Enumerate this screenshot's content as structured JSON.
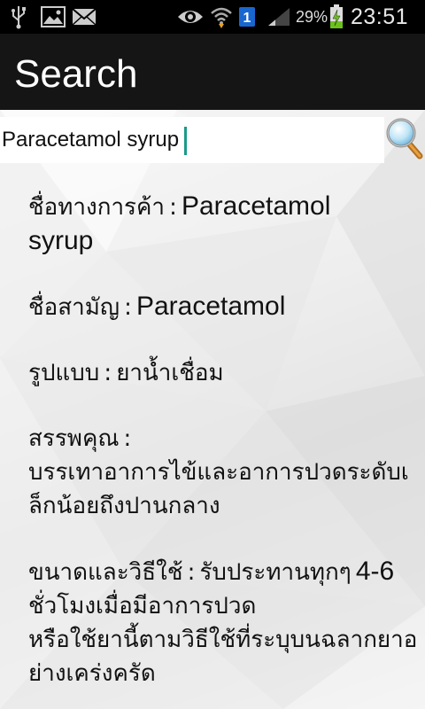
{
  "status_bar": {
    "battery_percent": "29%",
    "time": "23:51",
    "sim_number": "1",
    "icons": [
      "usb-icon",
      "gallery-icon",
      "mail-icon",
      "eye-icon",
      "wifi-icon",
      "sim-icon",
      "signal-icon",
      "battery-icon"
    ]
  },
  "action_bar": {
    "title": "Search"
  },
  "search": {
    "value": "Paracetamol syrup"
  },
  "info": {
    "trade_name_label": "ชื่อทางการค้า",
    "trade_name_value_line1": "Paracetamol",
    "trade_name_value_line2": "syrup",
    "generic_name_label": "ชื่อสามัญ",
    "generic_name_value": "Paracetamol",
    "form_label": "รูปแบบ",
    "form_value": "ยาน้ำเชื่อม",
    "indication_label": "สรรพคุณ",
    "indication_line1": "บรรเทาอาการไข้และอาการปวดระดับเ",
    "indication_line2": "ล็กน้อยถึงปานกลาง",
    "dosage_label": "ขนาดและวิธีใช้",
    "dosage_line1_text": "รับประทานทุกๆ",
    "dosage_line1_num": "4-6",
    "dosage_line2": "ชั่วโมงเมื่อมีอาการปวด",
    "dosage_line3": "หรือใช้ยานี้ตามวิธีใช้ที่ระบุบนฉลากยาอ",
    "dosage_line4": "ย่างเคร่งครัด",
    "separator": ":"
  }
}
